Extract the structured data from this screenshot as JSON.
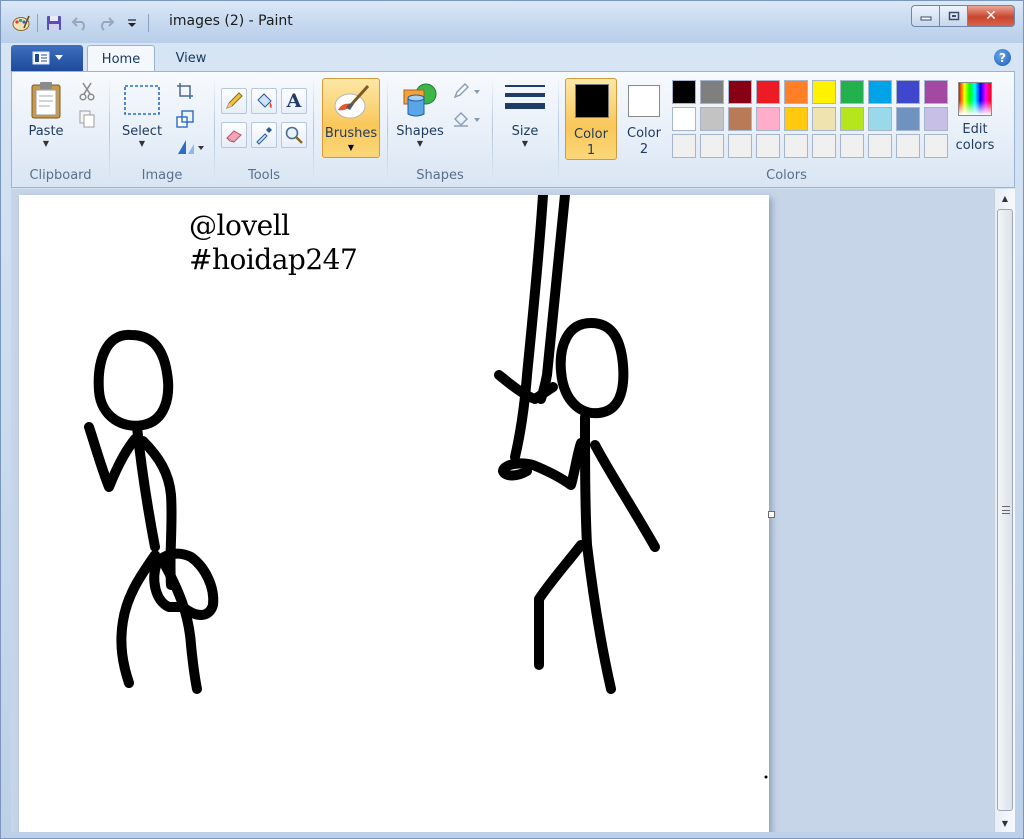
{
  "window": {
    "title": "images (2) - Paint",
    "close_glyph": "✕"
  },
  "tabs": [
    {
      "label": "Home"
    },
    {
      "label": "View"
    }
  ],
  "help_glyph": "?",
  "clipboard": {
    "paste_label": "Paste",
    "group_label": "Clipboard"
  },
  "image": {
    "select_label": "Select",
    "group_label": "Image"
  },
  "tools": {
    "text_tool_glyph": "A",
    "group_label": "Tools"
  },
  "brushes": {
    "label": "Brushes"
  },
  "shapes": {
    "label": "Shapes",
    "group_label": "Shapes"
  },
  "size": {
    "label": "Size"
  },
  "colors": {
    "color1_label_line1": "Color",
    "color1_label_line2": "1",
    "color2_label_line1": "Color",
    "color2_label_line2": "2",
    "edit_label_line1": "Edit",
    "edit_label_line2": "colors",
    "group_label": "Colors",
    "color1_value": "#000000",
    "color2_value": "#ffffff",
    "palette_row1": [
      "#000000",
      "#7f7f7f",
      "#880015",
      "#ed1c24",
      "#ff7f27",
      "#fff200",
      "#22b14c",
      "#00a2e8",
      "#3f48cc",
      "#a349a4"
    ],
    "palette_row2": [
      "#ffffff",
      "#c3c3c3",
      "#b97a57",
      "#ffaec9",
      "#ffc90e",
      "#efe4b0",
      "#b5e61d",
      "#99d9ea",
      "#7092be",
      "#c8bfe7"
    ],
    "palette_row3": [
      "#f0f0f0",
      "#f0f0f0",
      "#f0f0f0",
      "#f0f0f0",
      "#f0f0f0",
      "#f0f0f0",
      "#f0f0f0",
      "#f0f0f0",
      "#f0f0f0",
      "#f0f0f0"
    ]
  },
  "canvas": {
    "text_line1": "@lovell",
    "text_line2": "#hoidap247"
  }
}
